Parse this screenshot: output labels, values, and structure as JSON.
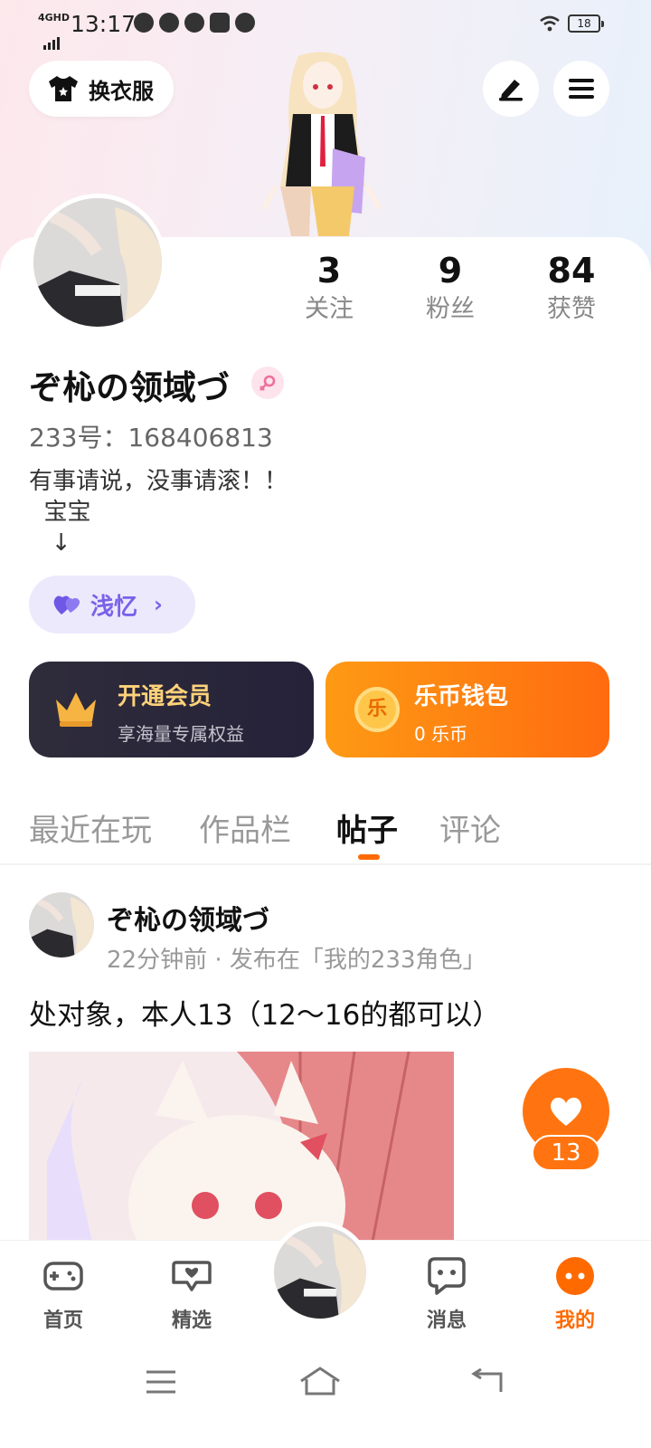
{
  "status_bar": {
    "network": "4GHD",
    "time": "13:17",
    "battery": "18"
  },
  "header": {
    "wardrobe_label": "换衣服",
    "edit_icon": "pen-icon",
    "menu_icon": "hamburger-icon"
  },
  "profile": {
    "username": "ぞ杺の领域づ",
    "uid": "233号：168406813",
    "bio": "有事请说，没事请滚！！\n  宝宝\n   ↓",
    "gender": "female",
    "tag_label": "浅忆"
  },
  "stats": [
    {
      "value": "3",
      "label": "关注"
    },
    {
      "value": "9",
      "label": "粉丝"
    },
    {
      "value": "84",
      "label": "获赞"
    }
  ],
  "cards": {
    "vip_title": "开通会员",
    "vip_sub": "享海量专属权益",
    "wallet_title": "乐币钱包",
    "wallet_sub": "0 乐币",
    "coin_char": "乐"
  },
  "tabs": [
    "最近在玩",
    "作品栏",
    "帖子",
    "评论"
  ],
  "active_tab": "帖子",
  "post": {
    "author": "ぞ杺の领域づ",
    "meta": "22分钟前 · 发布在「我的233角色」",
    "text": "处对象，本人13（12～16的都可以）",
    "likes": "13"
  },
  "bottom_nav": [
    {
      "label": "首页",
      "icon": "gamepad-icon"
    },
    {
      "label": "精选",
      "icon": "heart-chat-icon"
    },
    {
      "label": "消息",
      "icon": "message-icon"
    },
    {
      "label": "我的",
      "icon": "face-icon"
    }
  ],
  "colors": {
    "accent": "#ff6a00",
    "vip_bg": "#2f2c3b",
    "vip_text": "#ffd27a",
    "tag_bg": "#ece9fc",
    "tag_text": "#7a62e8"
  }
}
